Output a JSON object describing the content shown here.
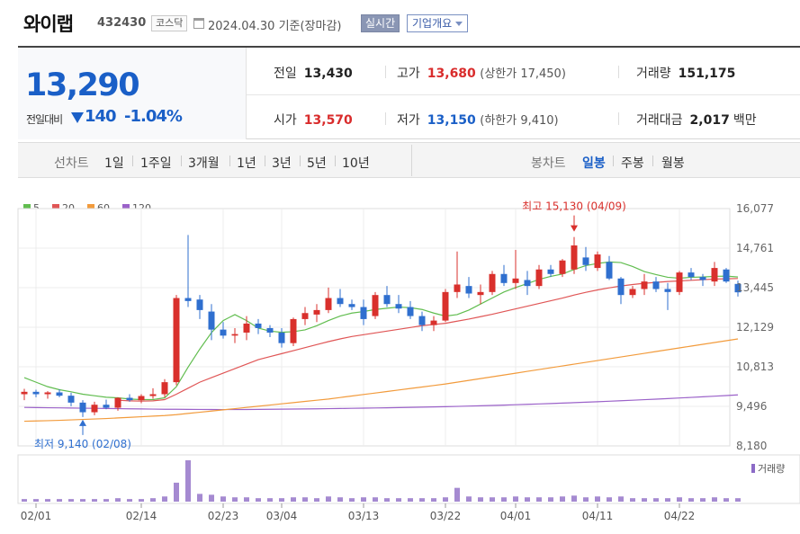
{
  "header": {
    "stock_name": "와이랩",
    "stock_code": "432430",
    "market": "코스닥",
    "date_text": "2024.04.30 기준(장마감)",
    "realtime_label": "실시간",
    "company_label": "기업개요"
  },
  "summary": {
    "price": "13,290",
    "change_label": "전일대비",
    "change_value": "140",
    "change_percent": "-1.04%",
    "prev_close_label": "전일",
    "prev_close": "13,430",
    "high_label": "고가",
    "high": "13,680",
    "upper_limit": "(상한가 17,450)",
    "volume_label": "거래량",
    "volume": "151,175",
    "open_label": "시가",
    "open": "13,570",
    "low_label": "저가",
    "low": "13,150",
    "lower_limit": "(하한가 9,410)",
    "amount_label": "거래대금",
    "amount": "2,017",
    "amount_unit": "백만"
  },
  "periods": {
    "label": "선차트",
    "items": [
      "1일",
      "1주일",
      "3개월",
      "1년",
      "3년",
      "5년",
      "10년"
    ],
    "candle_label": "봉차트",
    "candle_items": [
      "일봉",
      "주봉",
      "월봉"
    ],
    "active_candle": "일봉"
  },
  "colors": {
    "up": "#d9302c",
    "down": "#2f6fcf",
    "ma5": "#61bd4f",
    "ma20": "#e05656",
    "ma60": "#f29b3c",
    "ma120": "#9b62c9"
  },
  "chart_data": {
    "type": "candlestick",
    "legend": [
      {
        "name": "5",
        "color": "#61bd4f"
      },
      {
        "name": "20",
        "color": "#e05656"
      },
      {
        "name": "60",
        "color": "#f29b3c"
      },
      {
        "name": "120",
        "color": "#9b62c9"
      }
    ],
    "y_ticks": [
      "16,077",
      "14,761",
      "13,445",
      "12,129",
      "10,813",
      "9,496",
      "8,180"
    ],
    "ylim": [
      8180,
      16077
    ],
    "x_ticks": [
      {
        "label": "02/01",
        "index": 1
      },
      {
        "label": "02/14",
        "index": 10
      },
      {
        "label": "02/23",
        "index": 17
      },
      {
        "label": "03/04",
        "index": 22
      },
      {
        "label": "03/13",
        "index": 29
      },
      {
        "label": "03/22",
        "index": 36
      },
      {
        "label": "04/01",
        "index": 42
      },
      {
        "label": "04/11",
        "index": 49
      },
      {
        "label": "04/22",
        "index": 56
      }
    ],
    "annotations": {
      "high": {
        "text": "최고 15,130 (04/09)",
        "index": 47,
        "value": 15130
      },
      "low": {
        "text": "최저 9,140 (02/08)",
        "index": 5,
        "value": 9140
      }
    },
    "volume_label": "거래량",
    "candles": [
      [
        9900,
        10080,
        9700,
        9980
      ],
      [
        9980,
        10050,
        9800,
        9900
      ],
      [
        9900,
        10000,
        9750,
        9960
      ],
      [
        9960,
        10060,
        9800,
        9850
      ],
      [
        9850,
        9950,
        9500,
        9620
      ],
      [
        9620,
        9700,
        9140,
        9300
      ],
      [
        9300,
        9650,
        9200,
        9550
      ],
      [
        9550,
        9720,
        9400,
        9450
      ],
      [
        9450,
        9800,
        9350,
        9780
      ],
      [
        9780,
        9900,
        9650,
        9700
      ],
      [
        9700,
        9900,
        9600,
        9840
      ],
      [
        9840,
        10100,
        9750,
        9900
      ],
      [
        9900,
        10400,
        9800,
        10300
      ],
      [
        10300,
        13200,
        10200,
        13100
      ],
      [
        13100,
        15200,
        12800,
        13000
      ],
      [
        13050,
        13200,
        12400,
        12700
      ],
      [
        12650,
        12900,
        11700,
        12050
      ],
      [
        12050,
        12300,
        11750,
        11850
      ],
      [
        11850,
        12100,
        11600,
        11900
      ],
      [
        11950,
        12500,
        11700,
        12250
      ],
      [
        12250,
        12400,
        11900,
        12100
      ],
      [
        12100,
        12200,
        11800,
        11950
      ],
      [
        11950,
        12100,
        11450,
        11600
      ],
      [
        11600,
        12450,
        11500,
        12400
      ],
      [
        12400,
        12800,
        12200,
        12600
      ],
      [
        12550,
        12900,
        12300,
        12700
      ],
      [
        12700,
        13450,
        12600,
        13100
      ],
      [
        13100,
        13400,
        12800,
        12900
      ],
      [
        12900,
        13050,
        12700,
        12800
      ],
      [
        12800,
        13050,
        12200,
        12400
      ],
      [
        12500,
        13300,
        12400,
        13200
      ],
      [
        13200,
        13500,
        12800,
        12900
      ],
      [
        12900,
        13200,
        12600,
        12750
      ],
      [
        12800,
        13000,
        12400,
        12500
      ],
      [
        12500,
        12650,
        12000,
        12200
      ],
      [
        12200,
        12500,
        12000,
        12350
      ],
      [
        12350,
        13400,
        12300,
        13300
      ],
      [
        13300,
        14650,
        13100,
        13550
      ],
      [
        13500,
        13800,
        13100,
        13250
      ],
      [
        13200,
        13550,
        12900,
        13300
      ],
      [
        13300,
        14000,
        13200,
        13900
      ],
      [
        13900,
        14200,
        13500,
        13600
      ],
      [
        13600,
        14700,
        13400,
        13750
      ],
      [
        13700,
        14000,
        13200,
        13500
      ],
      [
        13500,
        14200,
        13400,
        14050
      ],
      [
        14050,
        14200,
        13800,
        13900
      ],
      [
        13900,
        14400,
        13800,
        14350
      ],
      [
        14050,
        15130,
        13900,
        14850
      ],
      [
        14450,
        14800,
        14000,
        14200
      ],
      [
        14100,
        14650,
        14000,
        14550
      ],
      [
        14300,
        14500,
        13700,
        13750
      ],
      [
        13750,
        13800,
        12900,
        13200
      ],
      [
        13200,
        13500,
        13100,
        13400
      ],
      [
        13400,
        13900,
        13200,
        13650
      ],
      [
        13650,
        13800,
        13300,
        13400
      ],
      [
        13400,
        13600,
        12700,
        13300
      ],
      [
        13300,
        14000,
        13200,
        13950
      ],
      [
        13950,
        14100,
        13700,
        13800
      ],
      [
        13800,
        13900,
        13500,
        13700
      ],
      [
        13650,
        14300,
        13500,
        14100
      ],
      [
        14050,
        14100,
        13600,
        13650
      ],
      [
        13570,
        13680,
        13150,
        13290
      ]
    ],
    "volume": [
      3,
      3,
      3,
      3,
      3,
      3,
      3,
      3,
      4,
      3,
      3,
      4,
      6,
      22,
      48,
      9,
      8,
      6,
      5,
      5,
      4,
      4,
      4,
      5,
      5,
      4,
      6,
      5,
      4,
      5,
      5,
      4,
      4,
      4,
      4,
      4,
      5,
      16,
      6,
      5,
      5,
      5,
      6,
      5,
      5,
      5,
      6,
      7,
      5,
      6,
      5,
      6,
      4,
      4,
      4,
      4,
      5,
      4,
      4,
      5,
      4,
      4
    ],
    "ma5": [
      10450,
      10300,
      10150,
      10050,
      9980,
      9900,
      9850,
      9800,
      9780,
      9740,
      9720,
      9720,
      9780,
      10150,
      10800,
      11400,
      11950,
      12350,
      12550,
      12350,
      12100,
      12000,
      11960,
      11980,
      12040,
      12180,
      12350,
      12500,
      12600,
      12650,
      12720,
      12760,
      12800,
      12780,
      12720,
      12600,
      12500,
      12550,
      12700,
      12900,
      13100,
      13300,
      13450,
      13580,
      13720,
      13820,
      13900,
      14050,
      14180,
      14250,
      14300,
      14280,
      14150,
      13980,
      13880,
      13790,
      13760,
      13790,
      13800,
      13820,
      13830,
      13800
    ],
    "ma20": [
      null,
      null,
      null,
      null,
      null,
      null,
      null,
      null,
      9700,
      9680,
      9670,
      9680,
      9720,
      9900,
      10100,
      10300,
      10450,
      10600,
      10750,
      10900,
      11050,
      11150,
      11250,
      11350,
      11450,
      11550,
      11650,
      11740,
      11820,
      11880,
      11940,
      12000,
      12060,
      12120,
      12180,
      12220,
      12260,
      12330,
      12400,
      12480,
      12560,
      12650,
      12740,
      12830,
      12920,
      13010,
      13100,
      13200,
      13290,
      13370,
      13440,
      13500,
      13550,
      13590,
      13620,
      13650,
      13670,
      13690,
      13710,
      13730,
      13740,
      13750
    ],
    "ma60": [
      9000,
      9010,
      9020,
      9030,
      9045,
      9060,
      9075,
      9090,
      9110,
      9130,
      9150,
      9170,
      9190,
      9220,
      9260,
      9300,
      9340,
      9380,
      9420,
      9460,
      9500,
      9540,
      9580,
      9620,
      9660,
      9700,
      9740,
      9790,
      9840,
      9890,
      9940,
      9990,
      10040,
      10090,
      10140,
      10190,
      10240,
      10300,
      10360,
      10420,
      10480,
      10540,
      10600,
      10660,
      10720,
      10780,
      10840,
      10900,
      10960,
      11020,
      11080,
      11140,
      11200,
      11260,
      11320,
      11380,
      11440,
      11500,
      11560,
      11620,
      11680,
      11740
    ],
    "ma120": [
      9460,
      9455,
      9450,
      9445,
      9440,
      9435,
      9430,
      9425,
      9420,
      9415,
      9410,
      9405,
      9400,
      9398,
      9396,
      9394,
      9392,
      9390,
      9390,
      9392,
      9395,
      9398,
      9402,
      9406,
      9410,
      9415,
      9420,
      9425,
      9430,
      9436,
      9442,
      9448,
      9455,
      9462,
      9470,
      9478,
      9486,
      9495,
      9505,
      9515,
      9526,
      9538,
      9550,
      9563,
      9576,
      9590,
      9604,
      9619,
      9634,
      9650,
      9666,
      9683,
      9700,
      9718,
      9736,
      9755,
      9774,
      9794,
      9814,
      9835,
      9856,
      9878
    ]
  }
}
